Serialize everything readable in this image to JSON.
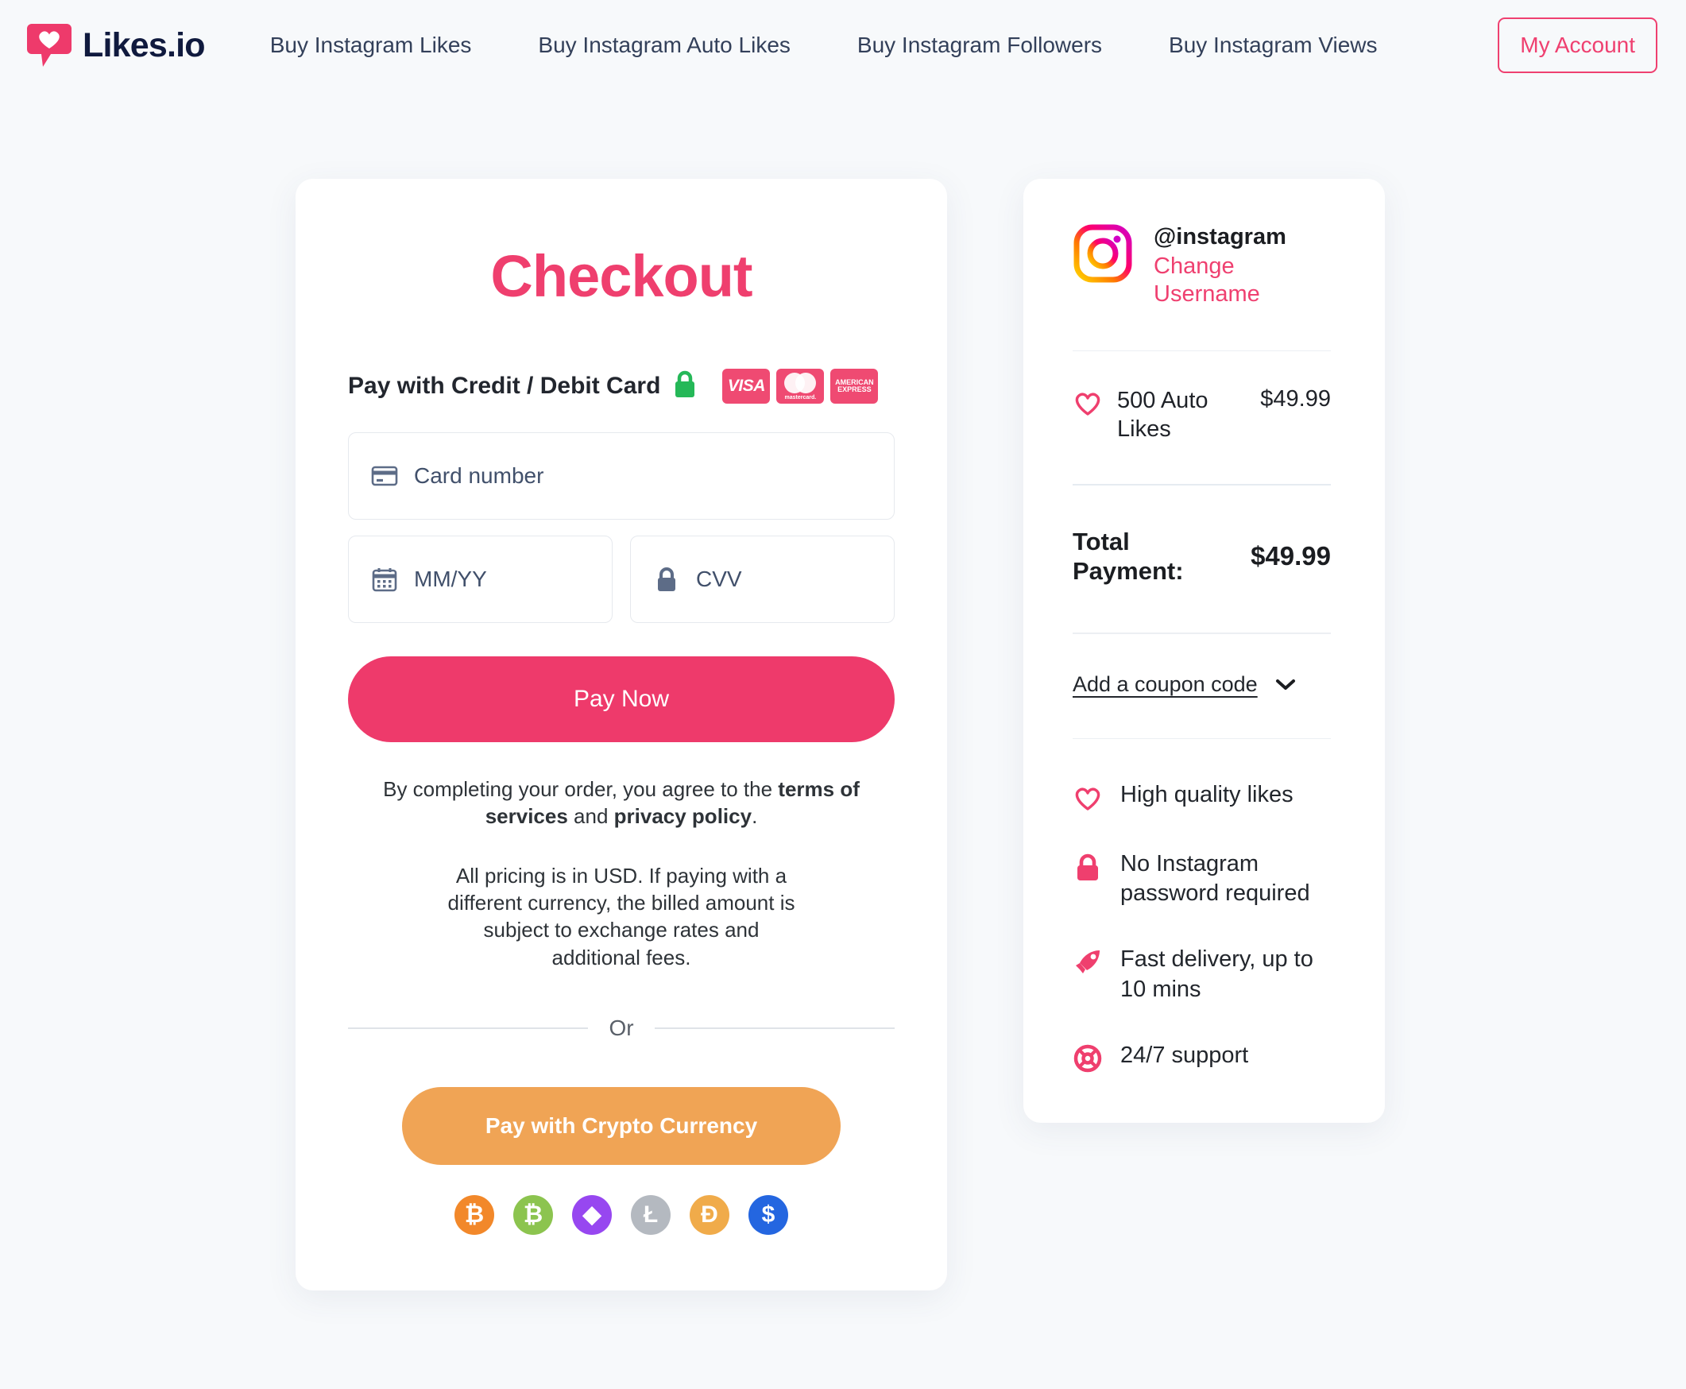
{
  "header": {
    "logo_text": "Likes.io",
    "logo_icon": "heart-badge-icon",
    "nav": [
      {
        "label": "Buy Instagram Likes"
      },
      {
        "label": "Buy Instagram Auto Likes"
      },
      {
        "label": "Buy Instagram Followers"
      },
      {
        "label": "Buy Instagram Views"
      }
    ],
    "account_button": "My Account",
    "accent_color": "#ef4070"
  },
  "checkout": {
    "title": "Checkout",
    "title_color": "#ef3f6e",
    "pay_with_label": "Pay with Credit / Debit Card",
    "lock_icon": "green-lock-icon",
    "brands": [
      {
        "name": "visa",
        "label": "VISA"
      },
      {
        "name": "mastercard",
        "label": "mastercard."
      },
      {
        "name": "amex",
        "line1": "AMERICAN",
        "line2": "EXPRESS"
      }
    ],
    "fields": {
      "card_number": {
        "placeholder": "Card number",
        "value": "",
        "icon": "credit-card-icon"
      },
      "expiry": {
        "placeholder": "MM/YY",
        "value": "",
        "icon": "calendar-icon"
      },
      "cvv": {
        "placeholder": "CVV",
        "value": "",
        "icon": "lock-icon"
      }
    },
    "pay_now_label": "Pay Now",
    "pay_now_color": "#ee3a6b",
    "terms_prefix": "By completing your order, you agree to the ",
    "terms_link_1": "terms of services",
    "terms_middle": " and ",
    "terms_link_2": "privacy policy",
    "terms_suffix": ".",
    "pricing_note": "All pricing is in USD. If paying with a different currency, the billed amount is subject to exchange rates and additional fees.",
    "or_label": "Or",
    "crypto_button_label": "Pay with Crypto Currency",
    "crypto_button_color": "#f0a455",
    "coins": [
      {
        "name": "bitcoin-icon",
        "symbol": "₿",
        "color": "#f2882a"
      },
      {
        "name": "bitcoin-cash-icon",
        "symbol": "₿",
        "color": "#8cc44f"
      },
      {
        "name": "ethereum-icon",
        "symbol": "◆",
        "color": "#9747f0"
      },
      {
        "name": "litecoin-icon",
        "symbol": "Ł",
        "color": "#b4b9c0"
      },
      {
        "name": "dai-icon",
        "symbol": "Đ",
        "color": "#f0ab4a"
      },
      {
        "name": "usd-coin-icon",
        "symbol": "$",
        "color": "#2466e0"
      }
    ]
  },
  "summary": {
    "instagram_icon": "instagram-icon",
    "username": "@instagram",
    "change_username_label": "Change Username",
    "change_username_color": "#ef4070",
    "items": [
      {
        "icon": "heart-icon",
        "name": "500 Auto Likes",
        "price": "$49.99"
      }
    ],
    "total_label": "Total Payment:",
    "total_amount": "$49.99",
    "coupon_label": "Add a coupon code",
    "coupon_chevron": "chevron-down-icon",
    "features": [
      {
        "icon": "heart-icon",
        "text": "High quality likes"
      },
      {
        "icon": "lock-icon",
        "text": "No Instagram password required"
      },
      {
        "icon": "rocket-icon",
        "text": "Fast delivery, up to 10 mins"
      },
      {
        "icon": "lifebuoy-icon",
        "text": "24/7 support"
      }
    ]
  }
}
